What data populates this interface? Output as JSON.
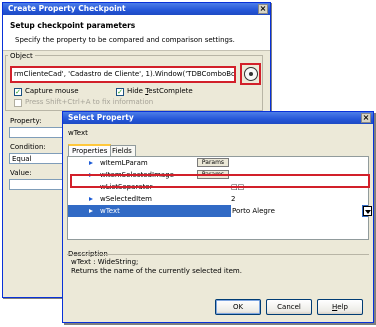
{
  "checkpoint_dialog": {
    "title": "Create Property Checkpoint",
    "close_glyph": "×",
    "header_title": "Setup checkpoint parameters",
    "header_subtitle": "Specify the property to be compared and comparison settings.",
    "object_group_label": "Object",
    "object_value": "rmClienteCad', 'Cadastro de Cliente', 1).Window('TDBComboBox', '', 1)",
    "capture_mouse": {
      "label": "Capture mouse",
      "checked": true
    },
    "hide_testcomplete": {
      "prefix": "Hide ",
      "underlined": "T",
      "suffix": "estComplete",
      "checked": true
    },
    "press_hint": "Press Shift+Ctrl+A to fix information",
    "property_label": "Property:",
    "property_value": "",
    "condition_label": "Condition:",
    "condition_value": "Equal",
    "value_label": "Value:",
    "value_value": ""
  },
  "select_property_dialog": {
    "title": "Select Property",
    "close_glyph": "×",
    "selected_property": "wText",
    "tabs": [
      "Properties",
      "Fields"
    ],
    "rows": [
      {
        "name": "wItemLParam",
        "button": "Params"
      },
      {
        "name": "wItemSelectedImage",
        "button": "Params"
      },
      {
        "name": "wListSeparator",
        "value": "□□"
      },
      {
        "name": "wSelectedItem",
        "value": "2"
      },
      {
        "name": "wText",
        "value": "Porto Alegre"
      }
    ],
    "description_title": "Description",
    "description_signature": "wText : WideString;",
    "description_text": "Returns the name of the currently selected item.",
    "buttons": {
      "ok": "OK",
      "cancel": "Cancel",
      "help_underlined": "H",
      "help_rest": "elp"
    }
  },
  "icons": {
    "finder": "crosshair-target-icon",
    "row_arrow": "triangle-right-icon",
    "dropdown": "chevron-down-icon"
  },
  "colors": {
    "title_bar": "#2556d8",
    "highlight": "#d2202a",
    "selection": "#316ac5",
    "face": "#ece9d8"
  }
}
